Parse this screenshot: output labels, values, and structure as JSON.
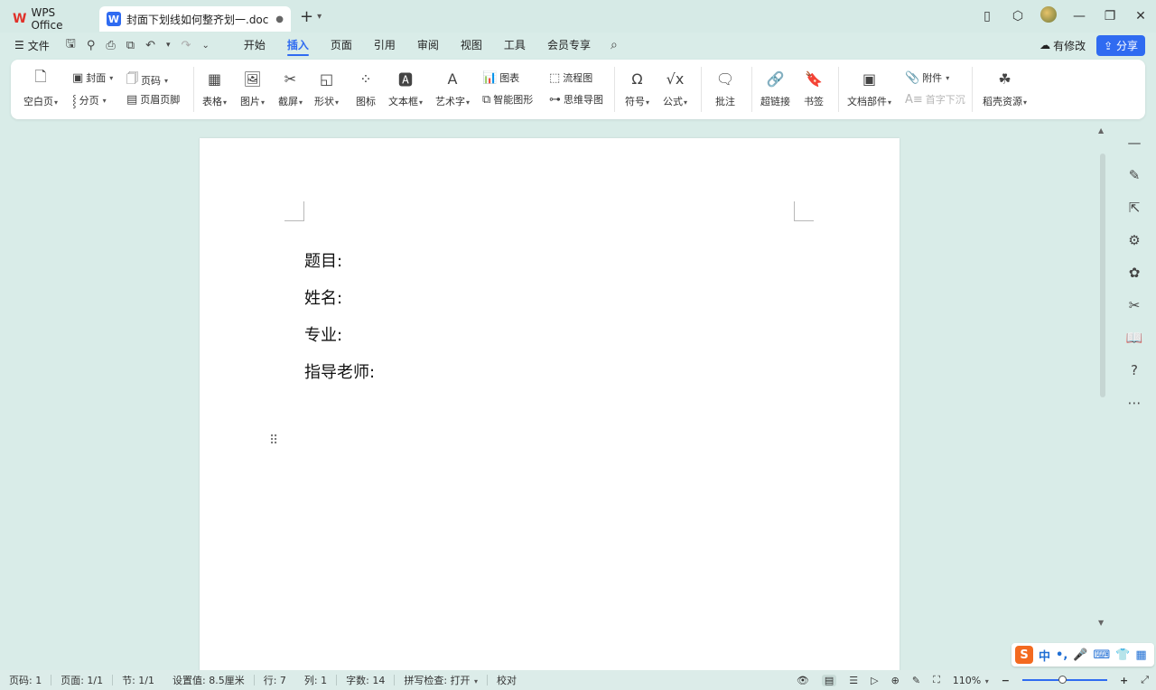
{
  "titlebar": {
    "home_tab": "WPS Office",
    "doc_tab": "封面下划线如何整齐划一.doc",
    "doc_badge": "W"
  },
  "menubar": {
    "file": "文件",
    "tabs": [
      "开始",
      "插入",
      "页面",
      "引用",
      "审阅",
      "视图",
      "工具",
      "会员专享"
    ],
    "active_tab": "插入",
    "save_status": "有修改",
    "share": "分享"
  },
  "ribbon": {
    "blank_page": "空白页",
    "cover": "封面",
    "page_number": "页码",
    "page_break": "分页",
    "header_footer": "页眉页脚",
    "table": "表格",
    "picture": "图片",
    "screenshot": "截屏",
    "shape": "形状",
    "icon": "图标",
    "textbox": "文本框",
    "wordart": "艺术字",
    "chart": "图表",
    "smart_graphic": "智能图形",
    "flowchart": "流程图",
    "mindmap": "思维导图",
    "symbol": "符号",
    "formula": "公式",
    "comment": "批注",
    "hyperlink": "超链接",
    "bookmark": "书签",
    "doc_parts": "文档部件",
    "attachment": "附件",
    "drop_cap": "首字下沉",
    "resources": "稻壳资源"
  },
  "document": {
    "lines": [
      "题目:",
      "姓名:",
      "专业:",
      "指导老师:"
    ]
  },
  "ime": {
    "logo": "S",
    "lang": "中",
    "punct": "•,"
  },
  "statusbar": {
    "page_no": "页码: 1",
    "pages": "页面: 1/1",
    "section": "节: 1/1",
    "setting": "设置值: 8.5厘米",
    "row": "行: 7",
    "col": "列: 1",
    "word_count": "字数: 14",
    "spell_check": "拼写检查: 打开",
    "proofread": "校对",
    "zoom": "110%",
    "zoom_fraction": 0.47
  },
  "colors": {
    "accent": "#2f6bf1",
    "background": "#d9ece8",
    "wps_red": "#e0322a"
  }
}
